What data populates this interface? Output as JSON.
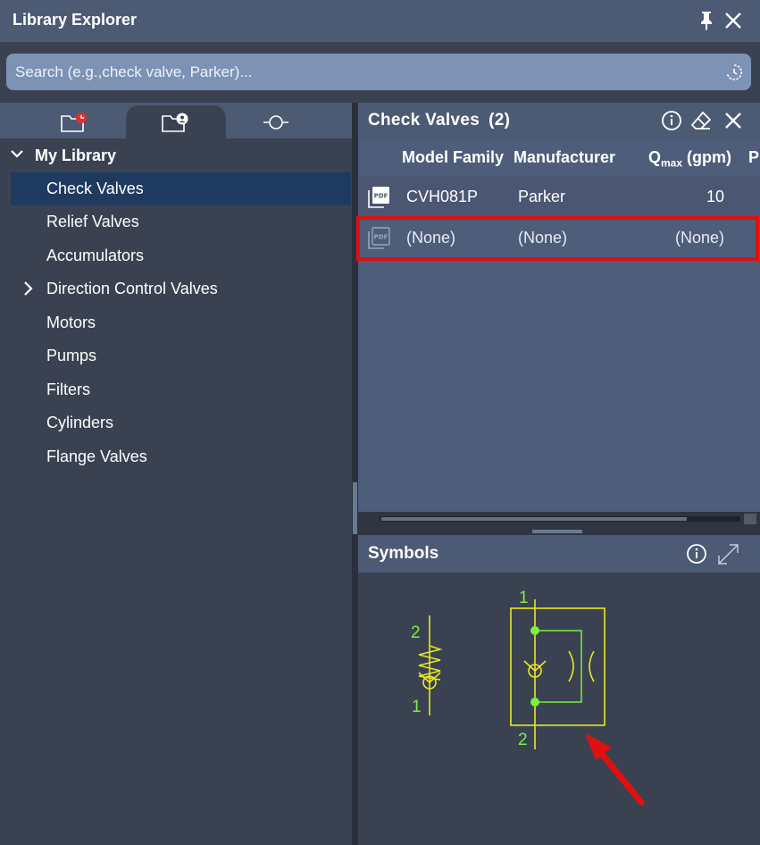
{
  "window": {
    "title": "Library Explorer"
  },
  "search": {
    "placeholder": "Search (e.g.,check valve, Parker)..."
  },
  "tree": {
    "root_label": "My Library",
    "items": [
      {
        "label": "Check Valves"
      },
      {
        "label": "Relief Valves"
      },
      {
        "label": "Accumulators"
      },
      {
        "label": "Direction Control Valves"
      },
      {
        "label": "Motors"
      },
      {
        "label": "Pumps"
      },
      {
        "label": "Filters"
      },
      {
        "label": "Cylinders"
      },
      {
        "label": "Flange Valves"
      }
    ]
  },
  "results": {
    "title": "Check Valves",
    "count": "(2)",
    "columns": {
      "model_family": "Model Family",
      "manufacturer": "Manufacturer",
      "qmax_main": "Q",
      "qmax_sub": "max",
      "qmax_unit": " (gpm)",
      "next": "P"
    },
    "rows": [
      {
        "model_family": "CVH081P",
        "manufacturer": "Parker",
        "qmax": "10"
      },
      {
        "model_family": "(None)",
        "manufacturer": "(None)",
        "qmax": "(None)"
      }
    ]
  },
  "symbols": {
    "title": "Symbols",
    "left_symbol": {
      "port_top": "2",
      "port_bottom": "1"
    },
    "right_symbol": {
      "port_top": "1",
      "port_bottom": "2"
    }
  },
  "colors": {
    "symbol_yellow": "#e8e822",
    "symbol_green": "#7cf03a",
    "highlight_red": "#e01010"
  }
}
